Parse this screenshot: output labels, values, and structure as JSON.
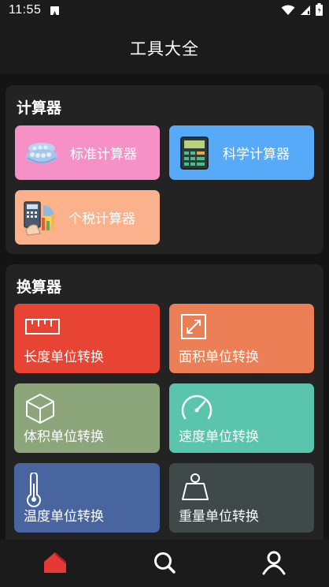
{
  "status_bar": {
    "time": "11:55",
    "notification_icon": "app-notification-icon",
    "icons": [
      "wifi-icon",
      "signal-icon",
      "battery-icon"
    ]
  },
  "app_bar": {
    "title": "工具大全"
  },
  "calculators": {
    "title": "计算器",
    "items": [
      {
        "label": "标准计算器",
        "icon": "abacus-icon",
        "color": "#f691c8"
      },
      {
        "label": "科学计算器",
        "icon": "scientific-calculator-icon",
        "color": "#57aaf7"
      },
      {
        "label": "个税计算器",
        "icon": "tax-calculator-icon",
        "color": "#fbb18c"
      }
    ]
  },
  "converters": {
    "title": "换算器",
    "items": [
      {
        "label": "长度单位转换",
        "icon": "ruler-icon",
        "color": "#e84433"
      },
      {
        "label": "面积单位转换",
        "icon": "area-expand-icon",
        "color": "#ec7f55"
      },
      {
        "label": "体积单位转换",
        "icon": "cube-icon",
        "color": "#8ca57b"
      },
      {
        "label": "速度单位转换",
        "icon": "speedometer-icon",
        "color": "#5bc4ad"
      },
      {
        "label": "温度单位转换",
        "icon": "thermometer-icon",
        "color": "#49659f"
      },
      {
        "label": "重量单位转换",
        "icon": "weight-icon",
        "color": "#3f494a"
      }
    ]
  },
  "bottom_nav": {
    "items": [
      {
        "icon": "home-icon",
        "active": true,
        "color": "#e53935"
      },
      {
        "icon": "search-icon",
        "active": false
      },
      {
        "icon": "profile-icon",
        "active": false
      }
    ]
  }
}
